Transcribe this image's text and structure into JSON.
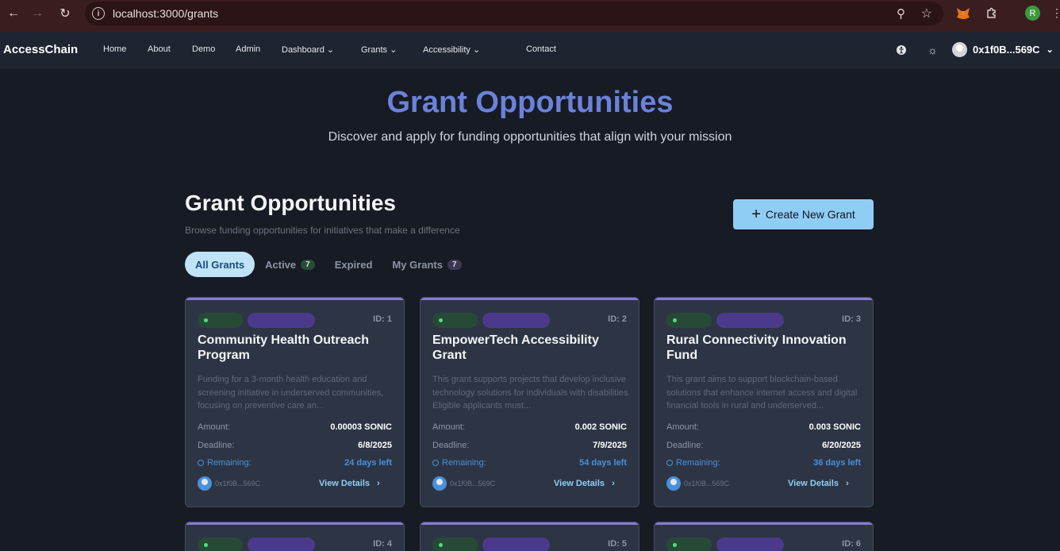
{
  "browser": {
    "url": "localhost:3000/grants",
    "profile_initial": "R"
  },
  "nav": {
    "brand": "AccessChain",
    "links": [
      "Home",
      "About",
      "Demo",
      "Admin",
      "Dashboard",
      "Grants",
      "Accessibility",
      "Contact"
    ],
    "dropdown_links": [
      "Dashboard",
      "Grants",
      "Accessibility"
    ],
    "account": "0x1f0B...569C"
  },
  "hero": {
    "title": "Grant Opportunities",
    "subtitle": "Discover and apply for funding opportunities that align with your mission"
  },
  "section": {
    "title": "Grant Opportunities",
    "subtitle": "Browse funding opportunities for initiatives that make a difference",
    "create_label": "Create New Grant"
  },
  "tabs": [
    {
      "label": "All Grants",
      "count": null
    },
    {
      "label": "Active",
      "count": "7"
    },
    {
      "label": "Expired",
      "count": null
    },
    {
      "label": "My Grants",
      "count": "7"
    }
  ],
  "labels": {
    "amount": "Amount:",
    "deadline": "Deadline:",
    "remaining": "Remaining:",
    "view_details": "View Details"
  },
  "cards": [
    {
      "id": "ID: 1",
      "title": "Community Health Outreach Program",
      "description": "Funding for a 3-month health education and screening initiative in underserved communities, focusing on preventive care an...",
      "amount": "0.00003 SONIC",
      "deadline": "6/8/2025",
      "remaining": "24 days left",
      "owner": "0x1f0B...569C"
    },
    {
      "id": "ID: 2",
      "title": "EmpowerTech Accessibility Grant",
      "description": "This grant supports projects that develop inclusive technology solutions for individuals with disabilities. Eligible applicants must...",
      "amount": "0.002 SONIC",
      "deadline": "7/9/2025",
      "remaining": "54 days left",
      "owner": "0x1f0B...569C"
    },
    {
      "id": "ID: 3",
      "title": "Rural Connectivity Innovation Fund",
      "description": "This grant aims to support blockchain-based solutions that enhance internet access and digital financial tools in rural and underserved...",
      "amount": "0.003 SONIC",
      "deadline": "6/20/2025",
      "remaining": "36 days left",
      "owner": "0x1f0B...569C"
    },
    {
      "id": "ID: 4"
    },
    {
      "id": "ID: 5"
    },
    {
      "id": "ID: 6"
    }
  ],
  "colors": {
    "accent_title": "#6b82d9",
    "create_button": "#90cdf4",
    "card_top_bar": "#8a79d6",
    "remaining": "#4a90d9"
  }
}
